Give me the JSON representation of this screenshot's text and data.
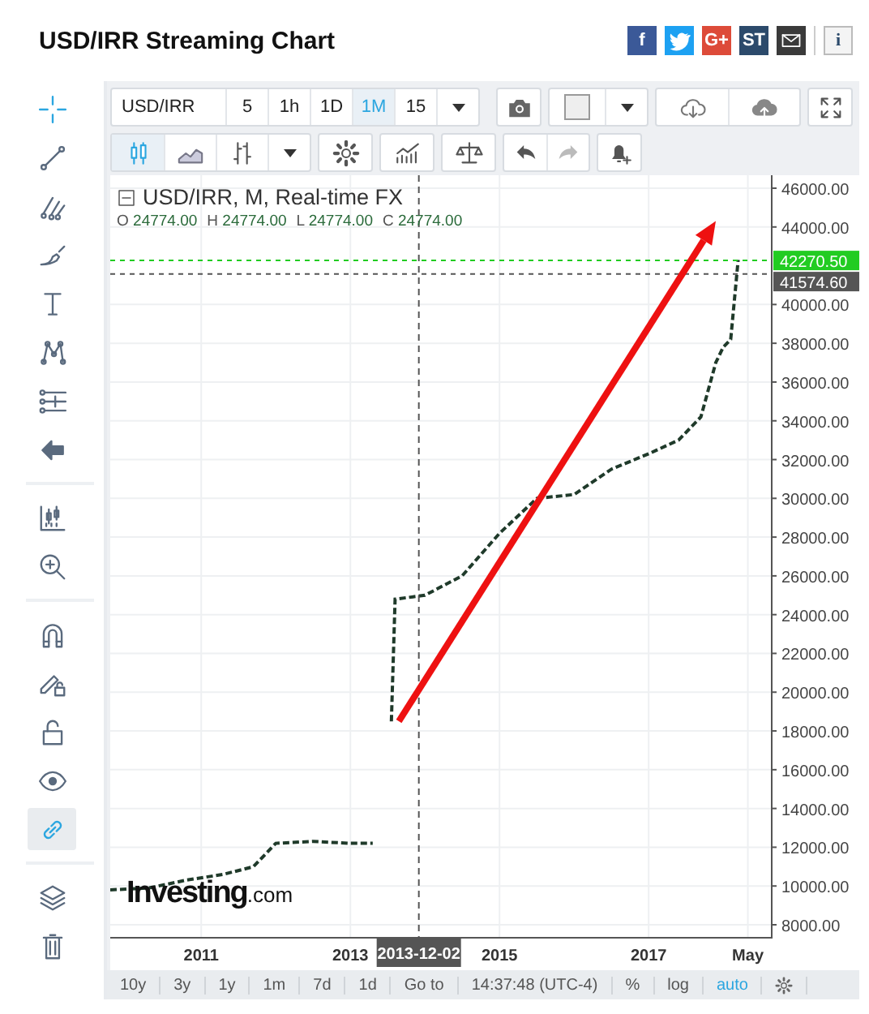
{
  "title": "USD/IRR Streaming Chart",
  "share": [
    {
      "kind": "facebook",
      "label": "f",
      "color": "#3b5998"
    },
    {
      "kind": "twitter",
      "color": "#1da1f2"
    },
    {
      "kind": "gplus",
      "label": "G+",
      "color": "#dd4b39"
    },
    {
      "kind": "stocktwits",
      "label": "ST",
      "color": "#2c4a6b"
    },
    {
      "kind": "mail",
      "color": "#3a3a3a"
    },
    {
      "kind": "info",
      "label": "i",
      "color": "#2c4a6b"
    }
  ],
  "sidebar": {
    "tools": [
      {
        "kind": "crosshair",
        "active": true,
        "selected": false
      },
      {
        "kind": "line",
        "active": false,
        "selected": false
      },
      {
        "kind": "pitchfork",
        "active": false,
        "selected": false
      },
      {
        "kind": "brush",
        "active": false,
        "selected": false
      },
      {
        "kind": "text",
        "active": false,
        "selected": false
      },
      {
        "kind": "pattern",
        "active": false,
        "selected": false
      },
      {
        "kind": "levels",
        "active": false,
        "selected": false
      },
      {
        "kind": "back",
        "active": false,
        "selected": false
      },
      {
        "kind": "measure",
        "active": false,
        "selected": false
      },
      {
        "kind": "zoom",
        "active": false,
        "selected": false
      },
      {
        "kind": "magnet",
        "active": false,
        "selected": false
      },
      {
        "kind": "pencil-lock",
        "active": false,
        "selected": false
      },
      {
        "kind": "lock",
        "active": false,
        "selected": false
      },
      {
        "kind": "eye",
        "active": false,
        "selected": false
      },
      {
        "kind": "link",
        "active": true,
        "selected": true
      },
      {
        "kind": "layers",
        "active": false,
        "selected": false
      },
      {
        "kind": "trash",
        "active": false,
        "selected": false
      }
    ]
  },
  "toolbar": {
    "symbol": "USD/IRR",
    "intervals": [
      {
        "label": "5",
        "selected": false
      },
      {
        "label": "1h",
        "selected": false
      },
      {
        "label": "1D",
        "selected": false
      },
      {
        "label": "1M",
        "selected": true
      },
      {
        "label": "15",
        "selected": false
      }
    ],
    "chart_types": [
      {
        "kind": "candles",
        "selected": true
      },
      {
        "kind": "area",
        "selected": false
      },
      {
        "kind": "bars",
        "selected": false
      }
    ],
    "actions": [
      {
        "kind": "undo",
        "disabled": false
      },
      {
        "kind": "redo",
        "disabled": true
      }
    ]
  },
  "chart": {
    "legend": "USD/IRR, M, Real-time FX",
    "ohlc": [
      {
        "key": "O",
        "value": "24774.00"
      },
      {
        "key": "H",
        "value": "24774.00"
      },
      {
        "key": "L",
        "value": "24774.00"
      },
      {
        "key": "C",
        "value": "24774.00"
      }
    ],
    "logo": {
      "name": "Investing",
      "suffix": ".com"
    },
    "chart_data": {
      "type": "line",
      "x": [
        2009.78,
        2010.3,
        2010.8,
        2011.3,
        2011.7,
        2012.0,
        2012.5,
        2013.0,
        2013.3,
        2013.52,
        2013.55,
        2013.6,
        2014.0,
        2014.5,
        2015.0,
        2015.5,
        2016.0,
        2016.5,
        2017.0,
        2017.4,
        2017.7,
        2017.9,
        2018.0,
        2018.1,
        2018.2
      ],
      "series": [
        {
          "color": "#1f3a2a",
          "line_style": "dashed",
          "values": [
            9800,
            9900,
            10300,
            10600,
            11000,
            12200,
            12300,
            12200,
            12200,
            null,
            18500,
            24800,
            25000,
            26000,
            28200,
            30000,
            30200,
            31500,
            32300,
            33000,
            34200,
            37000,
            37800,
            38200,
            42300
          ]
        }
      ],
      "grid": true,
      "xlim": [
        2009.78,
        2018.65
      ],
      "ylim": [
        8000,
        46000
      ],
      "xticks": [
        {
          "value": 2011,
          "label": "2011"
        },
        {
          "value": 2013,
          "label": "2013"
        },
        {
          "value": 2015,
          "label": "2015"
        },
        {
          "value": 2017,
          "label": "2017"
        },
        {
          "value": 2018.33,
          "label": "May"
        }
      ],
      "yticks": [
        {
          "value": 8000,
          "label": "8000.00"
        },
        {
          "value": 10000,
          "label": "10000.00"
        },
        {
          "value": 12000,
          "label": "12000.00"
        },
        {
          "value": 14000,
          "label": "14000.00"
        },
        {
          "value": 16000,
          "label": "16000.00"
        },
        {
          "value": 18000,
          "label": "18000.00"
        },
        {
          "value": 20000,
          "label": "20000.00"
        },
        {
          "value": 22000,
          "label": "22000.00"
        },
        {
          "value": 24000,
          "label": "24000.00"
        },
        {
          "value": 26000,
          "label": "26000.00"
        },
        {
          "value": 28000,
          "label": "28000.00"
        },
        {
          "value": 30000,
          "label": "30000.00"
        },
        {
          "value": 32000,
          "label": "32000.00"
        },
        {
          "value": 34000,
          "label": "34000.00"
        },
        {
          "value": 36000,
          "label": "36000.00"
        },
        {
          "value": 38000,
          "label": "38000.00"
        },
        {
          "value": 40000,
          "label": "40000.00"
        },
        {
          "value": 44000,
          "label": "44000.00"
        },
        {
          "value": 46000,
          "label": "46000.00"
        }
      ],
      "ref_lines": [
        {
          "axis": "y",
          "value": 42270.5,
          "label": "42270.50",
          "color": "#22cc22"
        },
        {
          "axis": "y",
          "value": 41574.6,
          "label": "41574.60",
          "color": "#555555"
        },
        {
          "axis": "x",
          "value": 2013.918,
          "color": "#555555"
        }
      ]
    },
    "cursor_date": "2013-12-02"
  },
  "range_bar": {
    "ranges": [
      "10y",
      "3y",
      "1y",
      "1m",
      "7d",
      "1d"
    ],
    "goto": "Go to",
    "time": "14:37:48 (UTC-4)",
    "options": [
      {
        "label": "%",
        "selected": false
      },
      {
        "label": "log",
        "selected": false
      },
      {
        "label": "auto",
        "selected": true
      }
    ]
  }
}
